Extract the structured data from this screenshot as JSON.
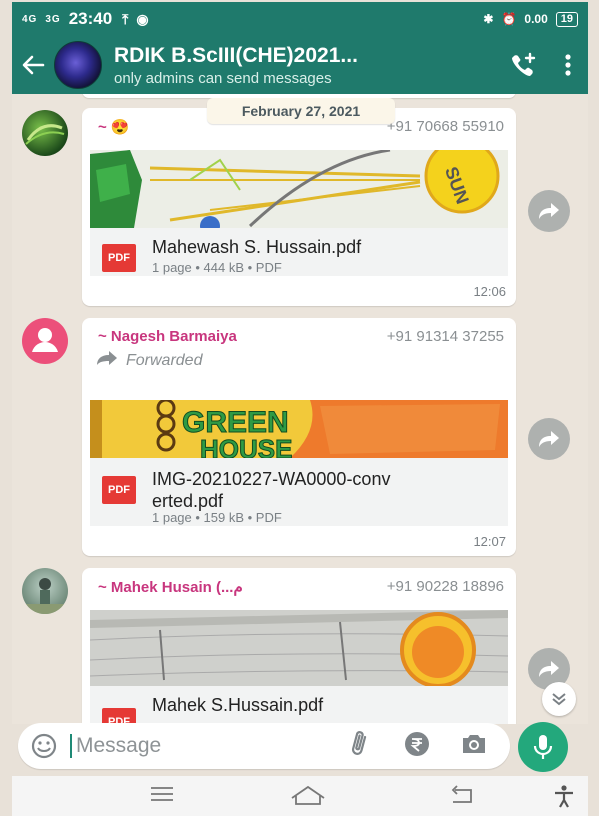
{
  "status_bar": {
    "network_1": "4G",
    "network_2": "3G",
    "time": "23:40",
    "speed": "0.00",
    "battery": "19"
  },
  "header": {
    "title": "RDIK B.ScIII(CHE)2021...",
    "subtitle": "only admins can send messages"
  },
  "chat": {
    "date_chip": "February 27, 2021",
    "messages": [
      {
        "sender": "~ 😍",
        "phone": "+91 70668 55910",
        "doc_name": "Mahewash S. Hussain.pdf",
        "doc_meta": "1 page • 444 kB • PDF",
        "time": "12:06",
        "thumb_text": "SUN"
      },
      {
        "sender": "~ Nagesh Barmaiya",
        "phone": "+91 91314 37255",
        "forwarded": "Forwarded",
        "doc_name": "IMG-20210227-WA0000-converted.pdf",
        "doc_name_line1": "IMG-20210227-WA0000-conv",
        "doc_name_line2": "erted.pdf",
        "doc_meta": "1 page • 159 kB • PDF",
        "time": "12:07",
        "thumb_text": "GREEN HOUSE"
      },
      {
        "sender": "~ Mahek Husain (...م",
        "phone": "+91 90228 18896",
        "doc_name": "Mahek S.Hussain.pdf"
      }
    ]
  },
  "composer": {
    "placeholder": "Message"
  },
  "pdf_badge": "PDF",
  "colors": {
    "header": "#1f7a6c",
    "sender_name": "#c8367e",
    "mic_button": "#23a87c",
    "pdf_badge": "#e53935"
  },
  "icons": [
    "back-arrow-icon",
    "add-call-icon",
    "more-vert-icon",
    "share-icon",
    "double-chevron-down-icon",
    "emoji-icon",
    "attach-icon",
    "rupee-icon",
    "camera-icon",
    "mic-icon",
    "menu-icon",
    "home-icon",
    "back-icon",
    "accessibility-icon"
  ]
}
